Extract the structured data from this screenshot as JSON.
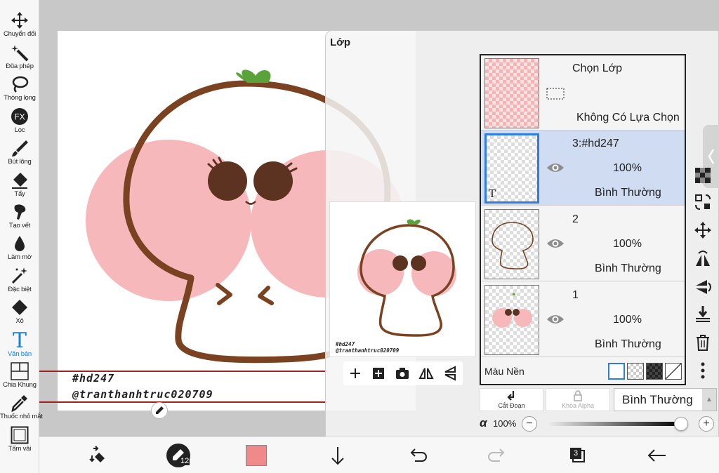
{
  "toolbar": {
    "items": [
      {
        "label": "Chuyển đổi",
        "icon": "move-arrows-icon"
      },
      {
        "label": "Đũa phép",
        "icon": "magic-wand-icon"
      },
      {
        "label": "Thòng lọng",
        "icon": "lasso-icon"
      },
      {
        "label": "Lọc",
        "icon": "fx-filter-icon",
        "badge": "FX"
      },
      {
        "label": "Bút lông",
        "icon": "brush-icon"
      },
      {
        "label": "Tẩy",
        "icon": "eraser-icon"
      },
      {
        "label": "Tạo vết",
        "icon": "smudge-icon"
      },
      {
        "label": "Làm mờ",
        "icon": "blur-drop-icon"
      },
      {
        "label": "Đặc biệt",
        "icon": "sparkle-icon"
      },
      {
        "label": "Xô",
        "icon": "bucket-icon"
      },
      {
        "label": "Văn bản",
        "icon": "text-icon",
        "glyph": "T",
        "active": true
      },
      {
        "label": "Chia Khung",
        "icon": "frame-divider-icon"
      },
      {
        "label": "Thuốc nhỏ mắt",
        "icon": "eyedropper-icon"
      },
      {
        "label": "Tấm vải",
        "icon": "canvas-icon"
      }
    ],
    "active_color": "#1a7be0"
  },
  "canvas": {
    "signature_line1": "#hd247",
    "signature_line2": "@tranthanhtruc020709"
  },
  "layer_panel": {
    "title": "Lớp",
    "preview": {
      "signature_line1": "#hd247",
      "signature_line2": "@tranthanhtruc020709"
    },
    "layers": [
      {
        "name": "Chọn Lớp",
        "status": "Không Có Lựa Chọn",
        "type": "selection"
      },
      {
        "name": "3:#hd247",
        "opacity": "100%",
        "blend": "Bình Thường",
        "selected": true,
        "thumb_glyph": "T"
      },
      {
        "name": "2",
        "opacity": "100%",
        "blend": "Bình Thường"
      },
      {
        "name": "1",
        "opacity": "100%",
        "blend": "Bình Thường"
      }
    ],
    "background_label": "Màu Nền",
    "buttons": {
      "clipping": "Cắt Đoạn",
      "alpha_lock": "Khóa Alpha",
      "blend_mode": "Bình Thường"
    },
    "alpha": {
      "symbol": "α",
      "value": "100%",
      "minus": "−",
      "plus": "+",
      "level": 1.0
    }
  },
  "bottom_bar": {
    "brush_size": "12",
    "color": "#f08a8a",
    "layer_count": "3"
  },
  "colors": {
    "accent": "#2f7de1",
    "selected_row": "#cfdcf2",
    "character_outline": "#7a4220",
    "character_blush": "#f7b8bb",
    "sprout": "#5aa23a"
  }
}
